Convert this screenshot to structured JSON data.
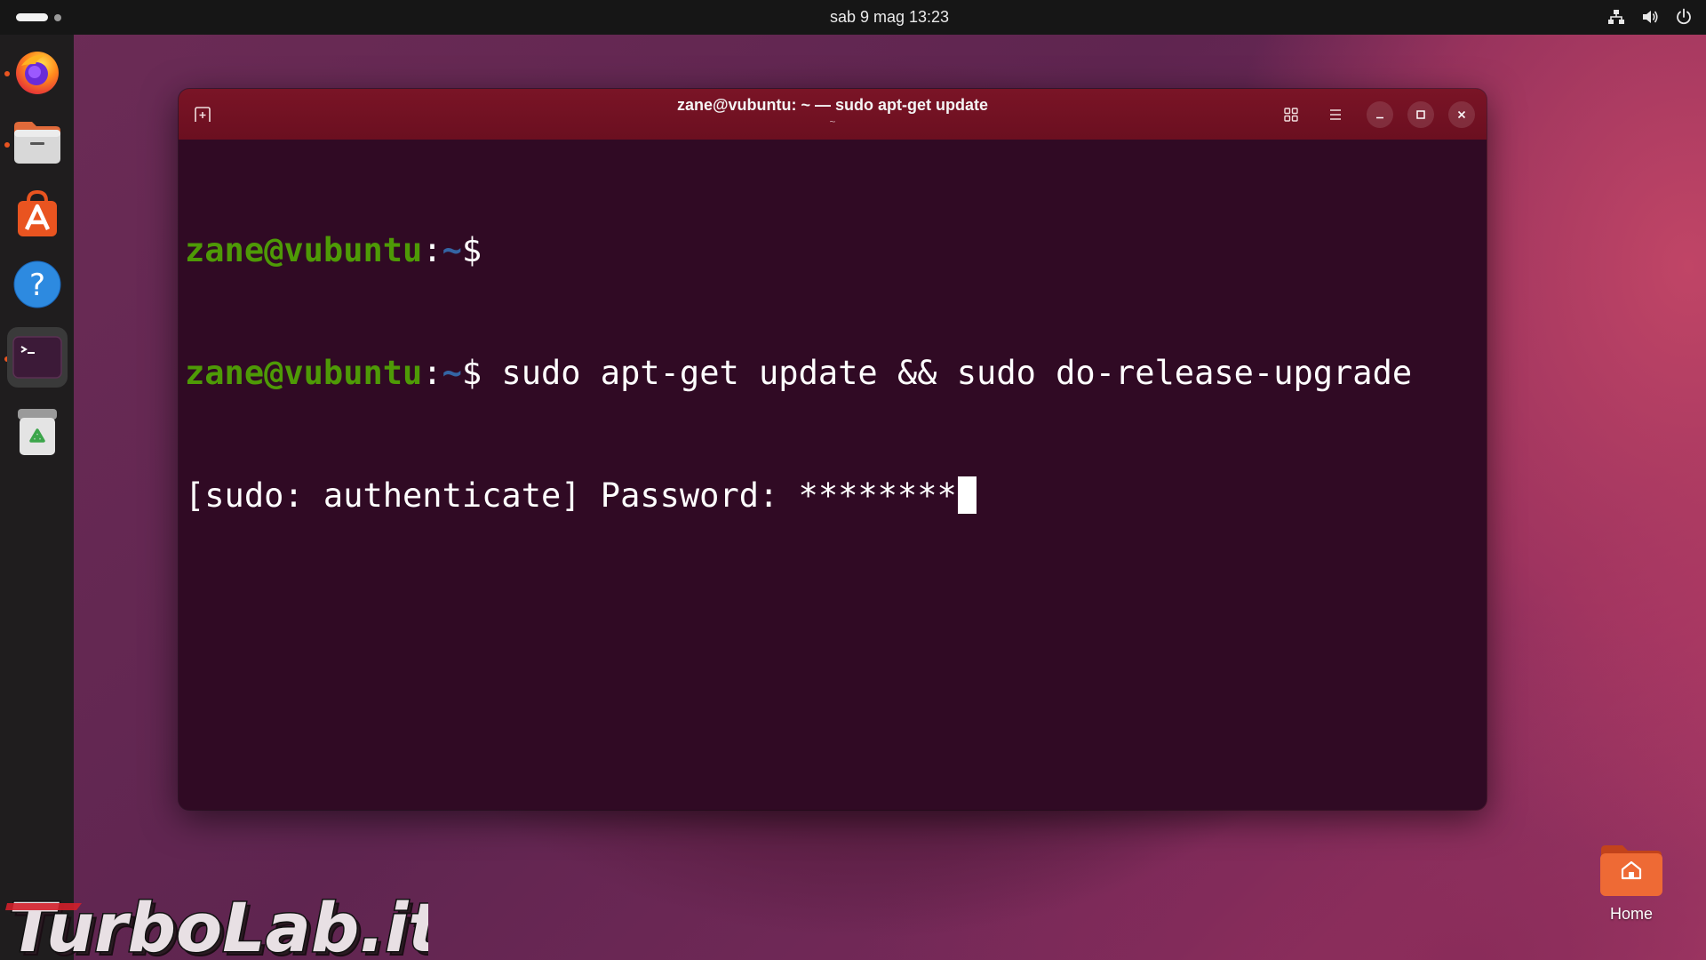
{
  "topbar": {
    "clock": "sab 9 mag  13:23",
    "icons": [
      "network-icon",
      "volume-icon",
      "power-icon"
    ]
  },
  "dock": {
    "items": [
      {
        "name": "firefox",
        "icon": "firefox-icon",
        "running": true,
        "active": false
      },
      {
        "name": "files",
        "icon": "files-icon",
        "running": true,
        "active": false
      },
      {
        "name": "app-center",
        "icon": "app-center-icon",
        "running": false,
        "active": false
      },
      {
        "name": "help",
        "icon": "help-icon",
        "running": false,
        "active": false
      },
      {
        "name": "terminal",
        "icon": "terminal-icon",
        "running": true,
        "active": true
      },
      {
        "name": "trash",
        "icon": "trash-icon",
        "running": false,
        "active": false
      }
    ]
  },
  "window": {
    "title": "zane@vubuntu: ~ — sudo apt-get update",
    "subtitle": "~",
    "buttons": [
      "new-tab",
      "tab-overview",
      "menu",
      "minimize",
      "maximize",
      "close"
    ]
  },
  "terminal": {
    "line1": {
      "user": "zane@vubuntu",
      "sep": ":",
      "path": "~",
      "prompt": "$"
    },
    "line2": {
      "user": "zane@vubuntu",
      "sep": ":",
      "path": "~",
      "prompt": "$",
      "command": " sudo apt-get update && sudo do-release-upgrade"
    },
    "line3": {
      "text": "[sudo: authenticate] Password: ********"
    }
  },
  "desktop": {
    "home_label": "Home"
  },
  "watermark": {
    "text": "TurboLab.it"
  },
  "colors": {
    "terminal_bg": "#300a24",
    "headerbar": "#6b0f20",
    "prompt_user": "#4e9a06",
    "prompt_path": "#3465a4",
    "accent": "#e95420"
  }
}
